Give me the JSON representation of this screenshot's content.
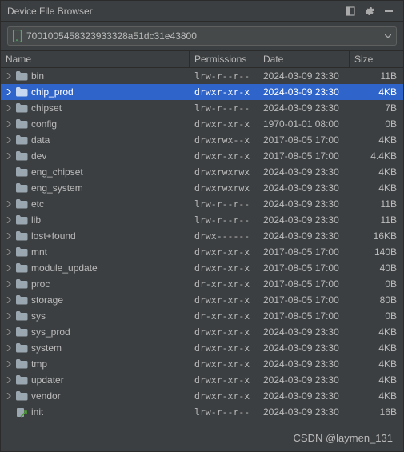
{
  "title": "Device File Browser",
  "device_id": "7001005458323933328a51dc31e43800",
  "columns": {
    "name": "Name",
    "permissions": "Permissions",
    "date": "Date",
    "size": "Size"
  },
  "watermark": "CSDN @laymen_131",
  "rows": [
    {
      "name": "bin",
      "type": "folder",
      "expandable": true,
      "selected": false,
      "perm": "lrw-r--r--",
      "date": "2024-03-09 23:30",
      "size": "11B"
    },
    {
      "name": "chip_prod",
      "type": "folder",
      "expandable": true,
      "selected": true,
      "perm": "drwxr-xr-x",
      "date": "2024-03-09 23:30",
      "size": "4KB"
    },
    {
      "name": "chipset",
      "type": "folder",
      "expandable": true,
      "selected": false,
      "perm": "lrw-r--r--",
      "date": "2024-03-09 23:30",
      "size": "7B"
    },
    {
      "name": "config",
      "type": "folder",
      "expandable": true,
      "selected": false,
      "perm": "drwxr-xr-x",
      "date": "1970-01-01 08:00",
      "size": "0B"
    },
    {
      "name": "data",
      "type": "folder",
      "expandable": true,
      "selected": false,
      "perm": "drwxrwx--x",
      "date": "2017-08-05 17:00",
      "size": "4KB"
    },
    {
      "name": "dev",
      "type": "folder",
      "expandable": true,
      "selected": false,
      "perm": "drwxr-xr-x",
      "date": "2017-08-05 17:00",
      "size": "4.4KB"
    },
    {
      "name": "eng_chipset",
      "type": "folder",
      "expandable": false,
      "selected": false,
      "perm": "drwxrwxrwx",
      "date": "2024-03-09 23:30",
      "size": "4KB"
    },
    {
      "name": "eng_system",
      "type": "folder",
      "expandable": false,
      "selected": false,
      "perm": "drwxrwxrwx",
      "date": "2024-03-09 23:30",
      "size": "4KB"
    },
    {
      "name": "etc",
      "type": "folder",
      "expandable": true,
      "selected": false,
      "perm": "lrw-r--r--",
      "date": "2024-03-09 23:30",
      "size": "11B"
    },
    {
      "name": "lib",
      "type": "folder",
      "expandable": true,
      "selected": false,
      "perm": "lrw-r--r--",
      "date": "2024-03-09 23:30",
      "size": "11B"
    },
    {
      "name": "lost+found",
      "type": "folder",
      "expandable": true,
      "selected": false,
      "perm": "drwx------",
      "date": "2024-03-09 23:30",
      "size": "16KB"
    },
    {
      "name": "mnt",
      "type": "folder",
      "expandable": true,
      "selected": false,
      "perm": "drwxr-xr-x",
      "date": "2017-08-05 17:00",
      "size": "140B"
    },
    {
      "name": "module_update",
      "type": "folder",
      "expandable": true,
      "selected": false,
      "perm": "drwxr-xr-x",
      "date": "2017-08-05 17:00",
      "size": "40B"
    },
    {
      "name": "proc",
      "type": "folder",
      "expandable": true,
      "selected": false,
      "perm": "dr-xr-xr-x",
      "date": "2017-08-05 17:00",
      "size": "0B"
    },
    {
      "name": "storage",
      "type": "folder",
      "expandable": true,
      "selected": false,
      "perm": "drwxr-xr-x",
      "date": "2017-08-05 17:00",
      "size": "80B"
    },
    {
      "name": "sys",
      "type": "folder",
      "expandable": true,
      "selected": false,
      "perm": "dr-xr-xr-x",
      "date": "2017-08-05 17:00",
      "size": "0B"
    },
    {
      "name": "sys_prod",
      "type": "folder",
      "expandable": true,
      "selected": false,
      "perm": "drwxr-xr-x",
      "date": "2024-03-09 23:30",
      "size": "4KB"
    },
    {
      "name": "system",
      "type": "folder",
      "expandable": true,
      "selected": false,
      "perm": "drwxr-xr-x",
      "date": "2024-03-09 23:30",
      "size": "4KB"
    },
    {
      "name": "tmp",
      "type": "folder",
      "expandable": true,
      "selected": false,
      "perm": "drwxr-xr-x",
      "date": "2024-03-09 23:30",
      "size": "4KB"
    },
    {
      "name": "updater",
      "type": "folder",
      "expandable": true,
      "selected": false,
      "perm": "drwxr-xr-x",
      "date": "2024-03-09 23:30",
      "size": "4KB"
    },
    {
      "name": "vendor",
      "type": "folder",
      "expandable": true,
      "selected": false,
      "perm": "drwxr-xr-x",
      "date": "2024-03-09 23:30",
      "size": "4KB"
    },
    {
      "name": "init",
      "type": "link",
      "expandable": false,
      "selected": false,
      "perm": "lrw-r--r--",
      "date": "2024-03-09 23:30",
      "size": "16B"
    }
  ]
}
